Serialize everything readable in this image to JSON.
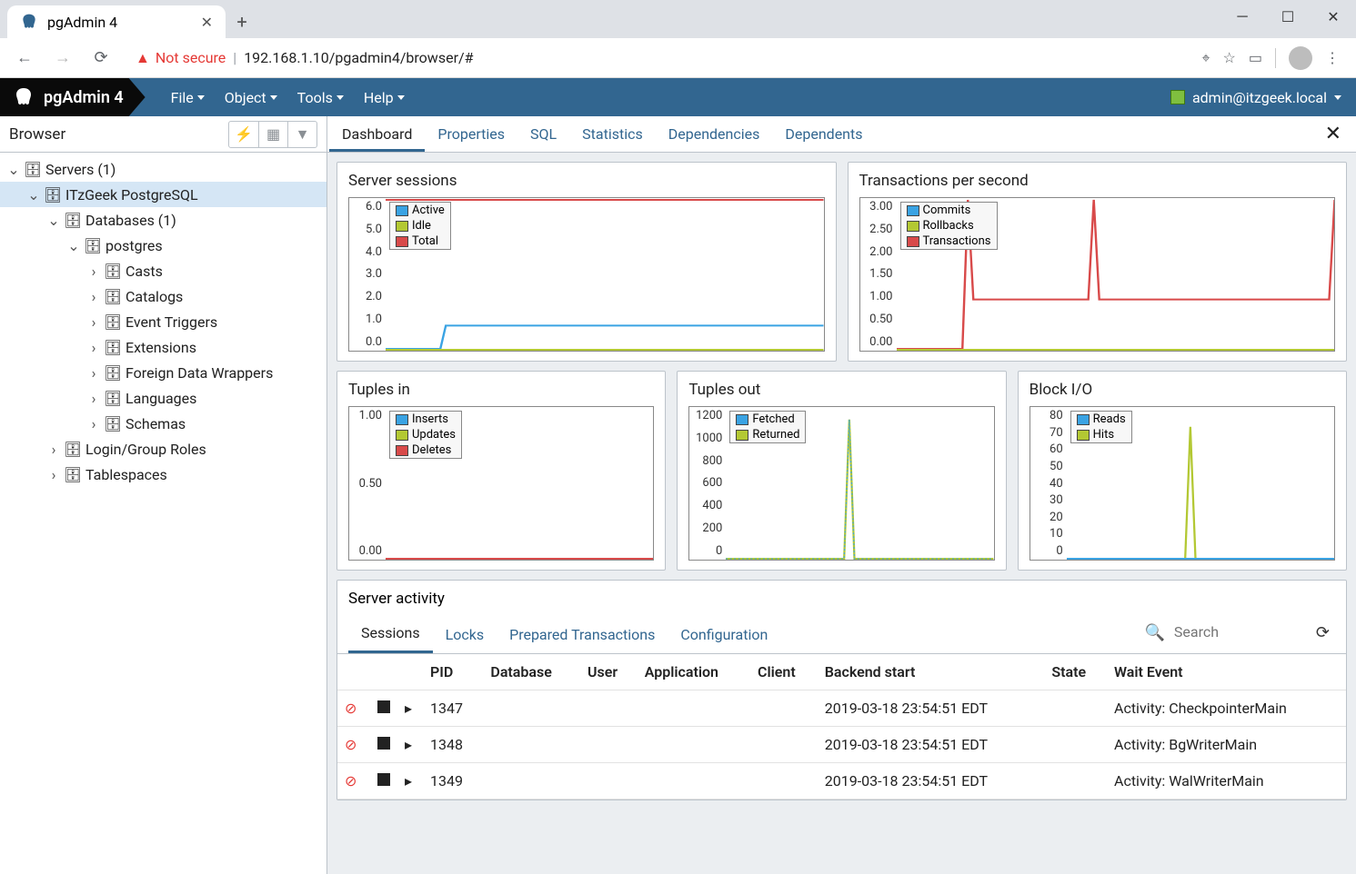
{
  "window": {
    "tab_title": "pgAdmin 4",
    "url": "192.168.1.10/pgadmin4/browser/#",
    "not_secure": "Not secure"
  },
  "brand": "pgAdmin 4",
  "menus": [
    "File",
    "Object",
    "Tools",
    "Help"
  ],
  "user": "admin@itzgeek.local",
  "sidebar": {
    "title": "Browser",
    "tree": [
      {
        "label": "Servers (1)",
        "indent": 0,
        "open": true,
        "icon": "server-group"
      },
      {
        "label": "ITzGeek PostgreSQL",
        "indent": 1,
        "open": true,
        "icon": "server",
        "selected": true
      },
      {
        "label": "Databases (1)",
        "indent": 2,
        "open": true,
        "icon": "database"
      },
      {
        "label": "postgres",
        "indent": 3,
        "open": true,
        "icon": "database-gold"
      },
      {
        "label": "Casts",
        "indent": 4,
        "open": false,
        "collapsed": true,
        "icon": "casts"
      },
      {
        "label": "Catalogs",
        "indent": 4,
        "open": false,
        "collapsed": true,
        "icon": "catalogs"
      },
      {
        "label": "Event Triggers",
        "indent": 4,
        "open": false,
        "collapsed": true,
        "icon": "event-triggers"
      },
      {
        "label": "Extensions",
        "indent": 4,
        "open": false,
        "collapsed": true,
        "icon": "extensions"
      },
      {
        "label": "Foreign Data Wrappers",
        "indent": 4,
        "open": false,
        "collapsed": true,
        "icon": "fdw"
      },
      {
        "label": "Languages",
        "indent": 4,
        "open": false,
        "collapsed": true,
        "icon": "languages"
      },
      {
        "label": "Schemas",
        "indent": 4,
        "open": false,
        "collapsed": true,
        "icon": "schemas"
      },
      {
        "label": "Login/Group Roles",
        "indent": 2,
        "open": false,
        "collapsed": true,
        "icon": "roles"
      },
      {
        "label": "Tablespaces",
        "indent": 2,
        "open": false,
        "collapsed": true,
        "icon": "tablespaces"
      }
    ]
  },
  "content_tabs": [
    "Dashboard",
    "Properties",
    "SQL",
    "Statistics",
    "Dependencies",
    "Dependents"
  ],
  "charts": {
    "sessions": {
      "title": "Server sessions",
      "yticks": [
        "6.0",
        "5.0",
        "4.0",
        "3.0",
        "2.0",
        "1.0",
        "0.0"
      ],
      "legend": [
        {
          "label": "Active",
          "color": "#3aa3e3"
        },
        {
          "label": "Idle",
          "color": "#b3c833"
        },
        {
          "label": "Total",
          "color": "#d84a4a"
        }
      ]
    },
    "tps": {
      "title": "Transactions per second",
      "yticks": [
        "3.00",
        "2.50",
        "2.00",
        "1.50",
        "1.00",
        "0.50",
        "0.00"
      ],
      "legend": [
        {
          "label": "Commits",
          "color": "#3aa3e3"
        },
        {
          "label": "Rollbacks",
          "color": "#b3c833"
        },
        {
          "label": "Transactions",
          "color": "#d84a4a"
        }
      ]
    },
    "tuples_in": {
      "title": "Tuples in",
      "yticks": [
        "1.00",
        "0.50",
        "0.00"
      ],
      "legend": [
        {
          "label": "Inserts",
          "color": "#3aa3e3"
        },
        {
          "label": "Updates",
          "color": "#b3c833"
        },
        {
          "label": "Deletes",
          "color": "#d84a4a"
        }
      ]
    },
    "tuples_out": {
      "title": "Tuples out",
      "yticks": [
        "1200",
        "1000",
        "800",
        "600",
        "400",
        "200",
        "0"
      ],
      "legend": [
        {
          "label": "Fetched",
          "color": "#3aa3e3"
        },
        {
          "label": "Returned",
          "color": "#b3c833"
        }
      ]
    },
    "block_io": {
      "title": "Block I/O",
      "yticks": [
        "80",
        "70",
        "60",
        "50",
        "40",
        "30",
        "20",
        "10",
        "0"
      ],
      "legend": [
        {
          "label": "Reads",
          "color": "#3aa3e3"
        },
        {
          "label": "Hits",
          "color": "#b3c833"
        }
      ]
    }
  },
  "activity": {
    "title": "Server activity",
    "tabs": [
      "Sessions",
      "Locks",
      "Prepared Transactions",
      "Configuration"
    ],
    "search_placeholder": "Search",
    "columns": [
      "PID",
      "Database",
      "User",
      "Application",
      "Client",
      "Backend start",
      "State",
      "Wait Event"
    ],
    "rows": [
      {
        "pid": "1347",
        "database": "",
        "user": "",
        "application": "",
        "client": "",
        "backend_start": "2019-03-18 23:54:51 EDT",
        "state": "",
        "wait_event": "Activity: CheckpointerMain"
      },
      {
        "pid": "1348",
        "database": "",
        "user": "",
        "application": "",
        "client": "",
        "backend_start": "2019-03-18 23:54:51 EDT",
        "state": "",
        "wait_event": "Activity: BgWriterMain"
      },
      {
        "pid": "1349",
        "database": "",
        "user": "",
        "application": "",
        "client": "",
        "backend_start": "2019-03-18 23:54:51 EDT",
        "state": "",
        "wait_event": "Activity: WalWriterMain"
      }
    ]
  },
  "chart_data": [
    {
      "type": "line",
      "title": "Server sessions",
      "ylim": [
        0,
        6
      ],
      "series": [
        {
          "name": "Active",
          "values": [
            0,
            0,
            1,
            1,
            1,
            1,
            1
          ]
        },
        {
          "name": "Idle",
          "values": [
            0,
            0,
            0,
            0,
            0,
            0,
            0
          ]
        },
        {
          "name": "Total",
          "values": [
            6,
            6,
            6,
            6,
            6,
            6,
            6
          ]
        }
      ]
    },
    {
      "type": "line",
      "title": "Transactions per second",
      "ylim": [
        0,
        3
      ],
      "series": [
        {
          "name": "Commits",
          "values": [
            0,
            0,
            0,
            0,
            0,
            0,
            0
          ]
        },
        {
          "name": "Rollbacks",
          "values": [
            0,
            0,
            0,
            0,
            0,
            0,
            0
          ]
        },
        {
          "name": "Transactions",
          "values": [
            0,
            0,
            3,
            1,
            1,
            3,
            1,
            1,
            1,
            1,
            1,
            1,
            1,
            3
          ]
        }
      ]
    },
    {
      "type": "line",
      "title": "Tuples in",
      "ylim": [
        0,
        1
      ],
      "series": [
        {
          "name": "Inserts",
          "values": [
            0,
            0,
            0,
            0,
            0
          ]
        },
        {
          "name": "Updates",
          "values": [
            0,
            0,
            0,
            0,
            0
          ]
        },
        {
          "name": "Deletes",
          "values": [
            0,
            0,
            0,
            0,
            0
          ]
        }
      ]
    },
    {
      "type": "line",
      "title": "Tuples out",
      "ylim": [
        0,
        1200
      ],
      "series": [
        {
          "name": "Fetched",
          "values": [
            0,
            0,
            0,
            0,
            1100,
            0,
            0,
            0,
            0,
            0
          ]
        },
        {
          "name": "Returned",
          "values": [
            0,
            0,
            0,
            0,
            1100,
            0,
            0,
            0,
            0,
            0
          ]
        }
      ]
    },
    {
      "type": "line",
      "title": "Block I/O",
      "ylim": [
        0,
        80
      ],
      "series": [
        {
          "name": "Reads",
          "values": [
            0,
            0,
            0,
            0,
            0,
            0,
            0,
            0,
            0
          ]
        },
        {
          "name": "Hits",
          "values": [
            0,
            0,
            0,
            0,
            70,
            0,
            0,
            0,
            0
          ]
        }
      ]
    }
  ]
}
